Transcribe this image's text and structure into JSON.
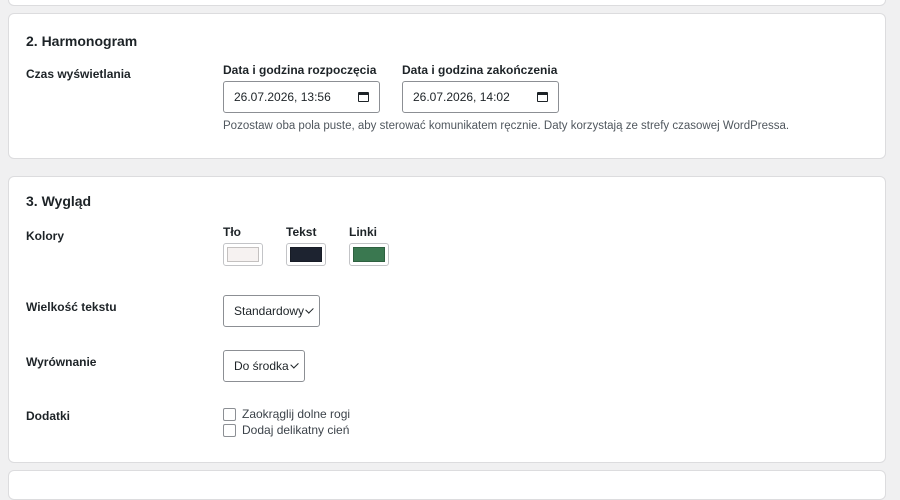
{
  "schedule": {
    "title": "2. Harmonogram",
    "display_time_label": "Czas wyświetlania",
    "start": {
      "label": "Data i godzina rozpoczęcia",
      "value": "26.07.2026, 13:56"
    },
    "end": {
      "label": "Data i godzina zakończenia",
      "value": "26.07.2026, 14:02"
    },
    "help": "Pozostaw oba pola puste, aby sterować komunikatem ręcznie. Daty korzystają ze strefy czasowej WordPressa."
  },
  "appearance": {
    "title": "3. Wygląd",
    "colors": {
      "label": "Kolory",
      "background": {
        "label": "Tło",
        "color": "#f6f2f1"
      },
      "text": {
        "label": "Tekst",
        "color": "#1d2330"
      },
      "links": {
        "label": "Linki",
        "color": "#3a7850"
      }
    },
    "text_size": {
      "label": "Wielkość tekstu",
      "selected": "Standardowy"
    },
    "alignment": {
      "label": "Wyrównanie",
      "selected": "Do środka"
    },
    "extras": {
      "label": "Dodatki",
      "options": [
        {
          "label": "Zaokrąglij dolne rogi",
          "checked": false
        },
        {
          "label": "Dodaj delikatny cień",
          "checked": false
        }
      ]
    }
  }
}
